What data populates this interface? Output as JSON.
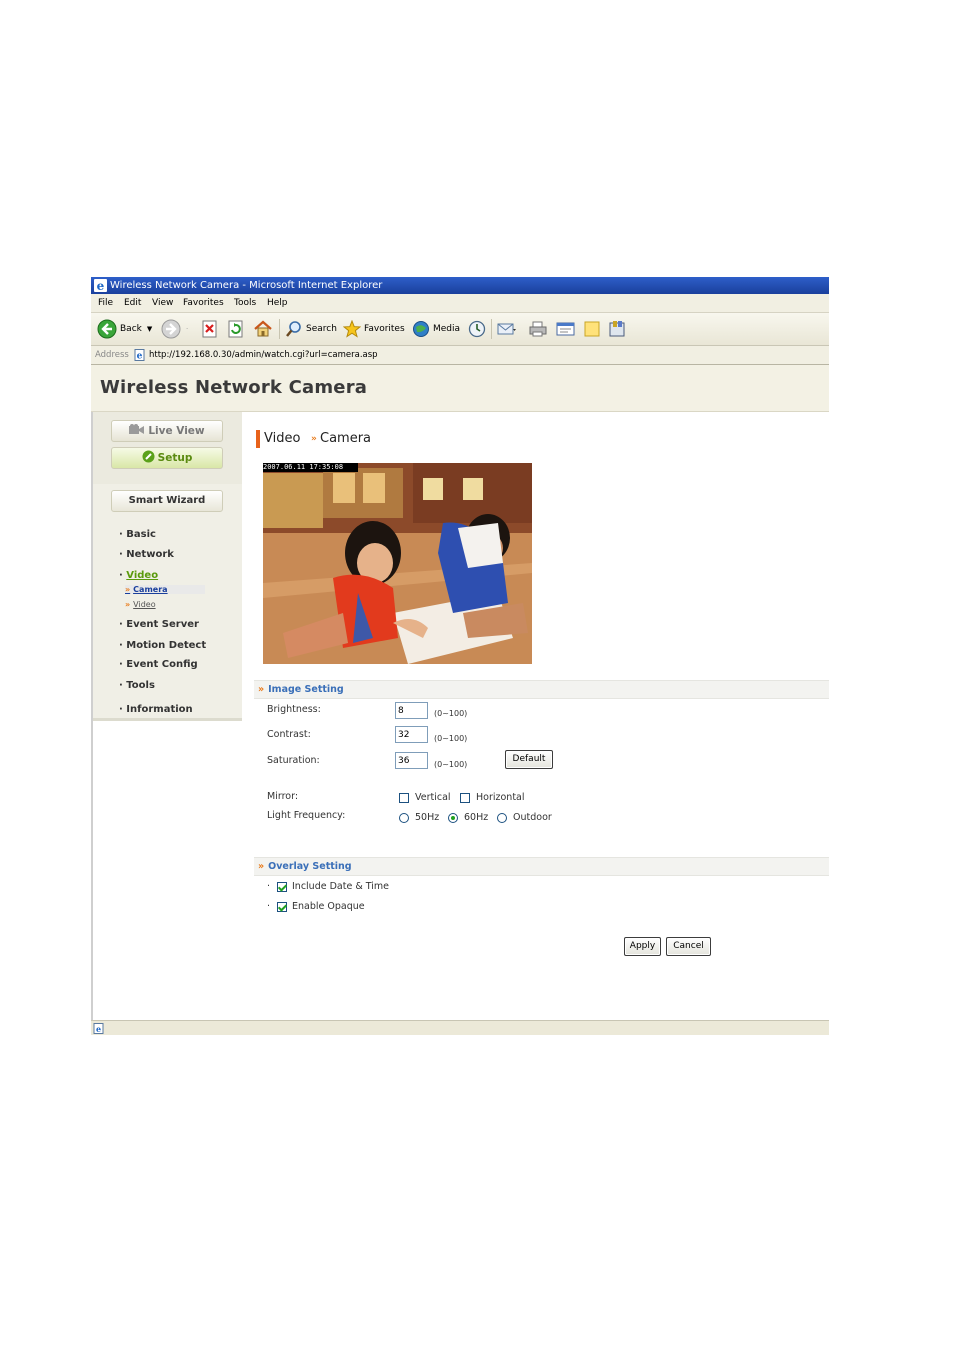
{
  "window": {
    "title": "Wireless Network Camera - Microsoft Internet Explorer"
  },
  "menu": [
    "File",
    "Edit",
    "View",
    "Favorites",
    "Tools",
    "Help"
  ],
  "toolbar": {
    "back_label": "Back",
    "search_label": "Search",
    "favorites_label": "Favorites",
    "media_label": "Media"
  },
  "address": {
    "label": "Address",
    "url": "http://192.168.0.30/admin/watch.cgi?url=camera.asp"
  },
  "app": {
    "title": "Wireless Network Camera"
  },
  "sidebar": {
    "live_view": "Live View",
    "setup": "Setup",
    "smart_wizard": "Smart Wizard",
    "items": [
      {
        "label": "Basic"
      },
      {
        "label": "Network"
      },
      {
        "label": "Video"
      },
      {
        "label": "Event Server"
      },
      {
        "label": "Motion Detect"
      },
      {
        "label": "Event Config"
      },
      {
        "label": "Tools"
      },
      {
        "label": "Information"
      }
    ],
    "subitems": [
      {
        "label": "Camera"
      },
      {
        "label": "Video"
      }
    ]
  },
  "page": {
    "title": "Video",
    "subtitle": "Camera"
  },
  "preview": {
    "timestamp": "2007.06.11 17:35:08"
  },
  "image_setting": {
    "heading": "Image Setting",
    "brightness_label": "Brightness:",
    "brightness_value": "8",
    "brightness_range": "(0~100)",
    "contrast_label": "Contrast:",
    "contrast_value": "32",
    "contrast_range": "(0~100)",
    "saturation_label": "Saturation:",
    "saturation_value": "36",
    "saturation_range": "(0~100)",
    "default_button": "Default",
    "mirror_label": "Mirror:",
    "vertical_label": "Vertical",
    "vertical_checked": false,
    "horizontal_label": "Horizontal",
    "horizontal_checked": false,
    "light_frequency_label": "Light Frequency:",
    "frequency_options": [
      "50Hz",
      "60Hz",
      "Outdoor"
    ],
    "frequency_selected": "60Hz"
  },
  "overlay_setting": {
    "heading": "Overlay Setting",
    "include_date_label": "Include Date & Time",
    "include_date_checked": true,
    "enable_opaque_label": "Enable Opaque",
    "enable_opaque_checked": true
  },
  "actions": {
    "apply": "Apply",
    "cancel": "Cancel"
  },
  "colors": {
    "accent_orange": "#e8621a",
    "section_blue": "#3a6fb8",
    "setup_green": "#5a8a10",
    "titlebar_blue": "#2e5fc9"
  }
}
